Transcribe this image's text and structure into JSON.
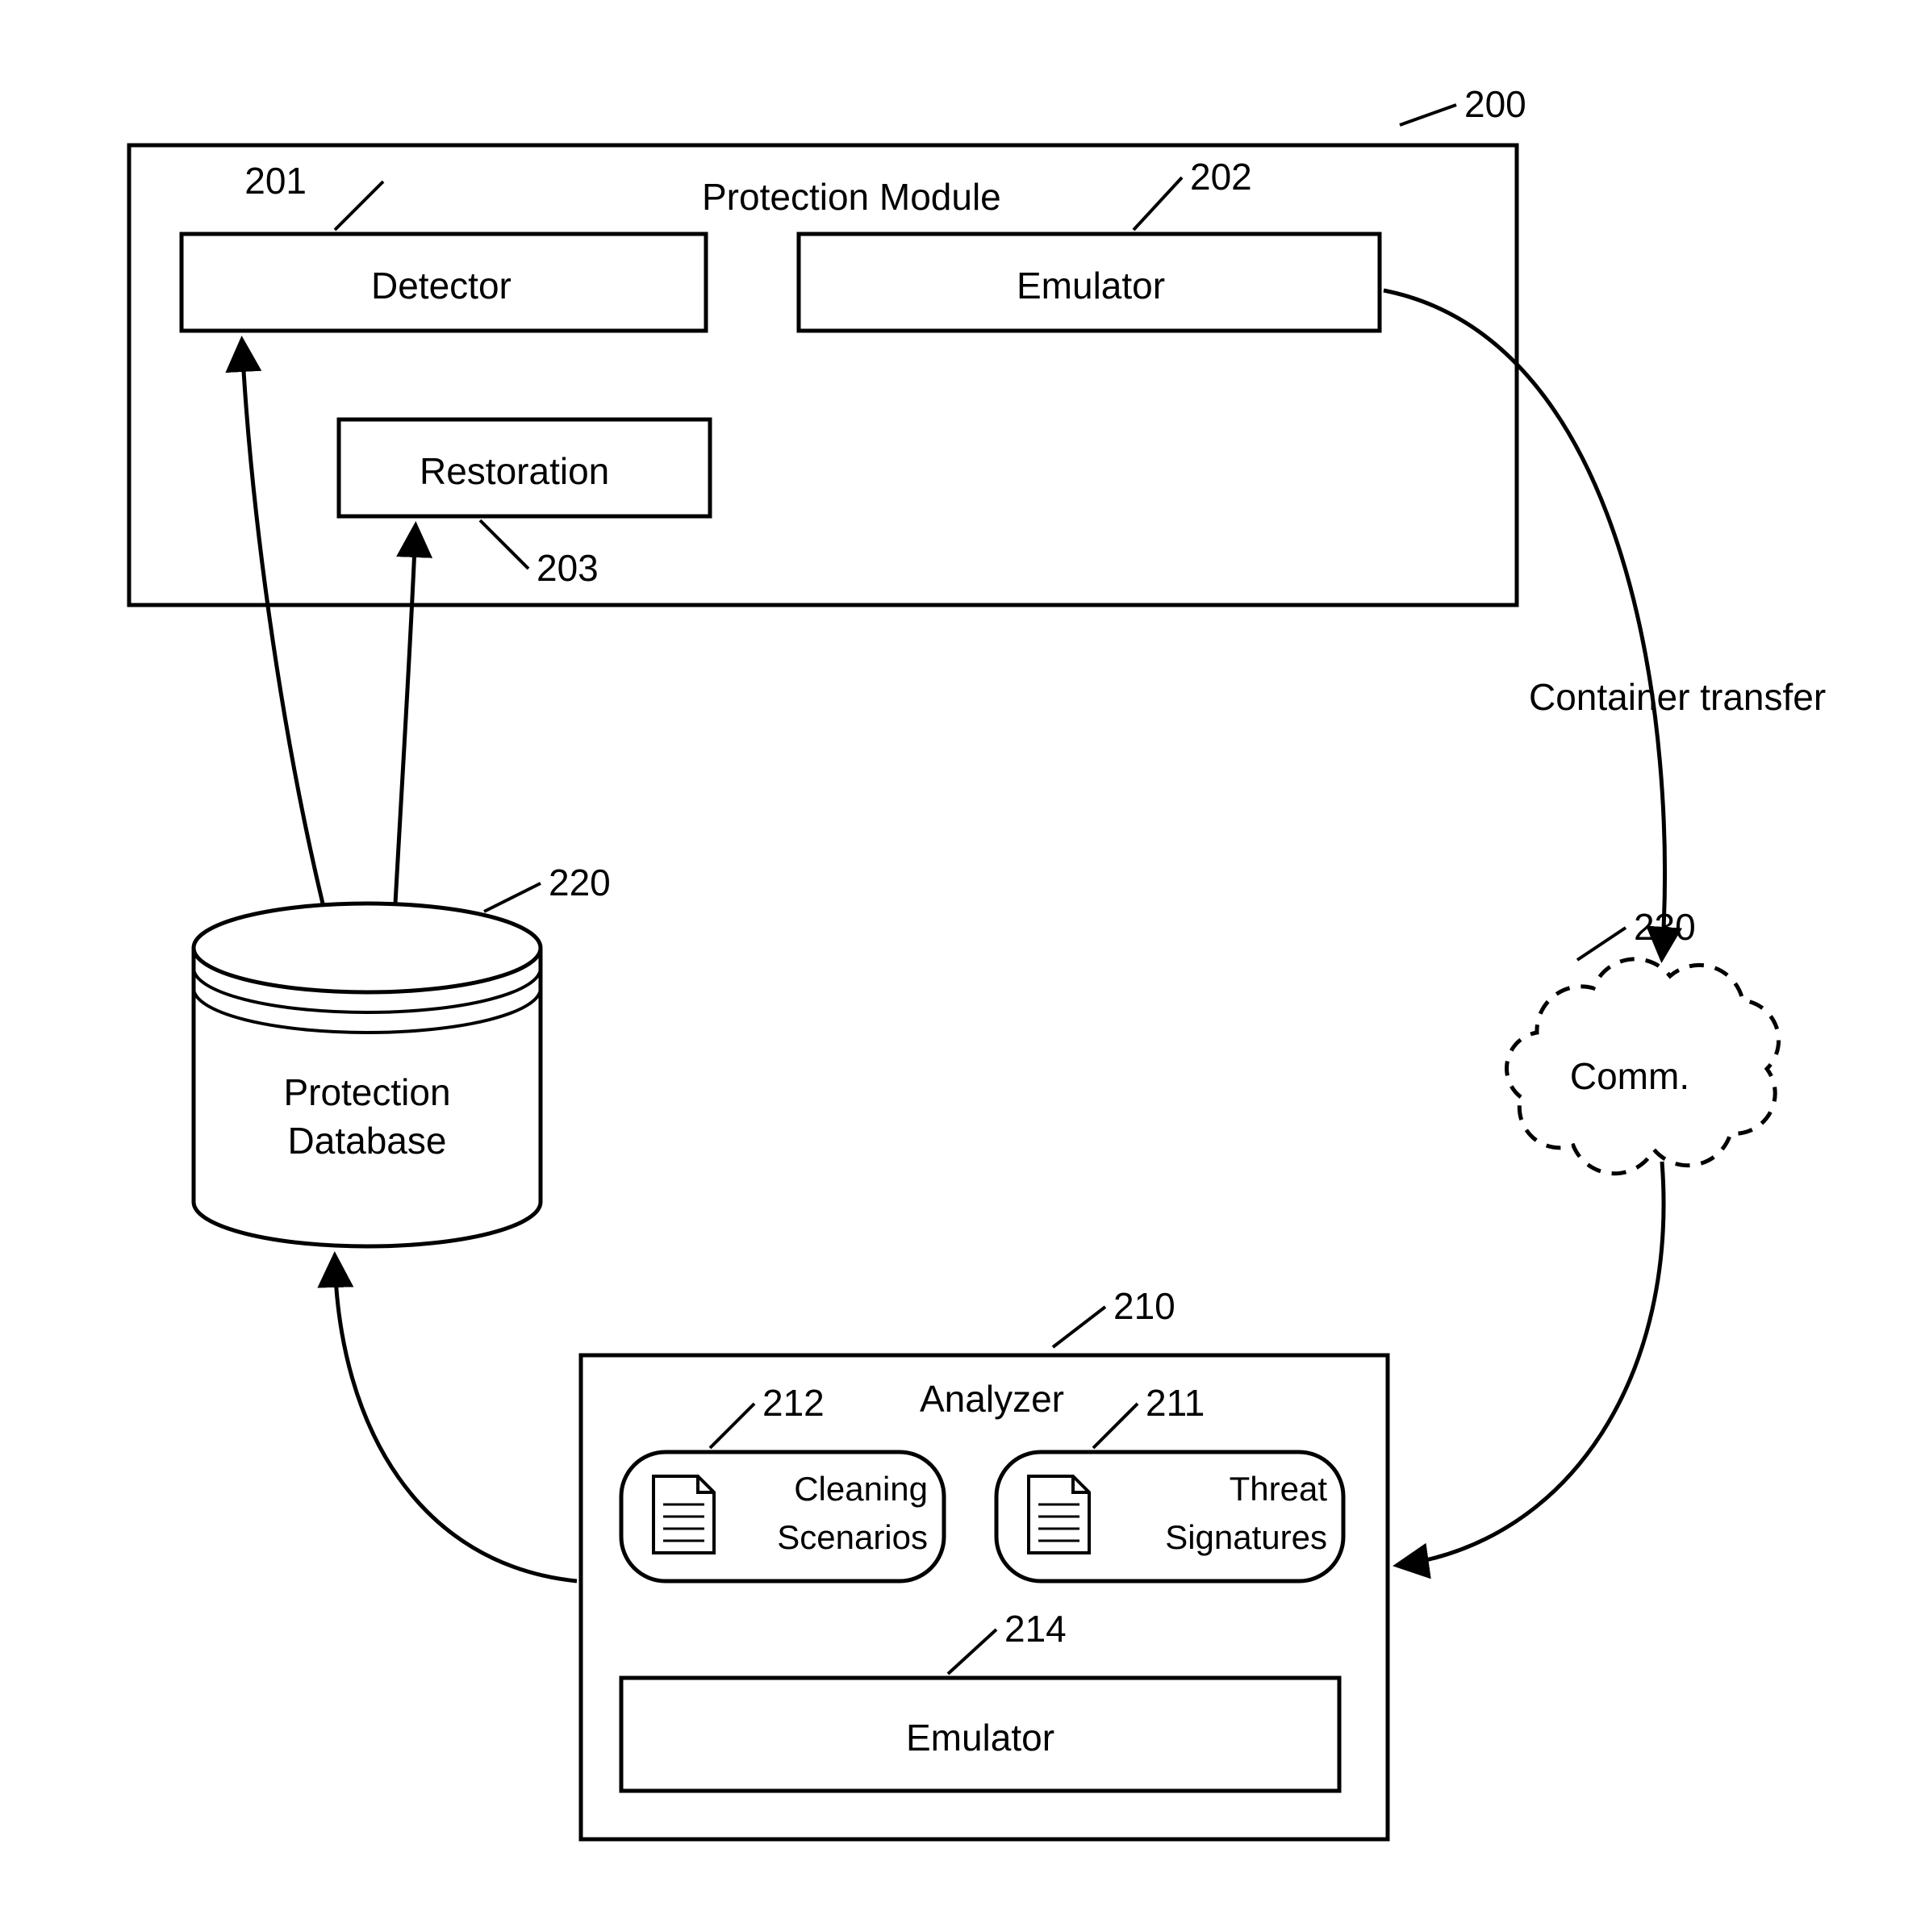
{
  "protectionModule": {
    "title": "Protection Module",
    "ref": "200",
    "detector": {
      "label": "Detector",
      "ref": "201"
    },
    "emulator": {
      "label": "Emulator",
      "ref": "202"
    },
    "restoration": {
      "label": "Restoration",
      "ref": "203"
    }
  },
  "database": {
    "label1": "Protection",
    "label2": "Database",
    "ref": "220"
  },
  "comm": {
    "label": "Comm.",
    "ref": "230"
  },
  "transferLabel": "Container transfer",
  "analyzer": {
    "title": "Analyzer",
    "ref": "210",
    "cleaning": {
      "label1": "Cleaning",
      "label2": "Scenarios",
      "ref": "212"
    },
    "threat": {
      "label1": "Threat",
      "label2": "Signatures",
      "ref": "211"
    },
    "emulator": {
      "label": "Emulator",
      "ref": "214"
    }
  }
}
